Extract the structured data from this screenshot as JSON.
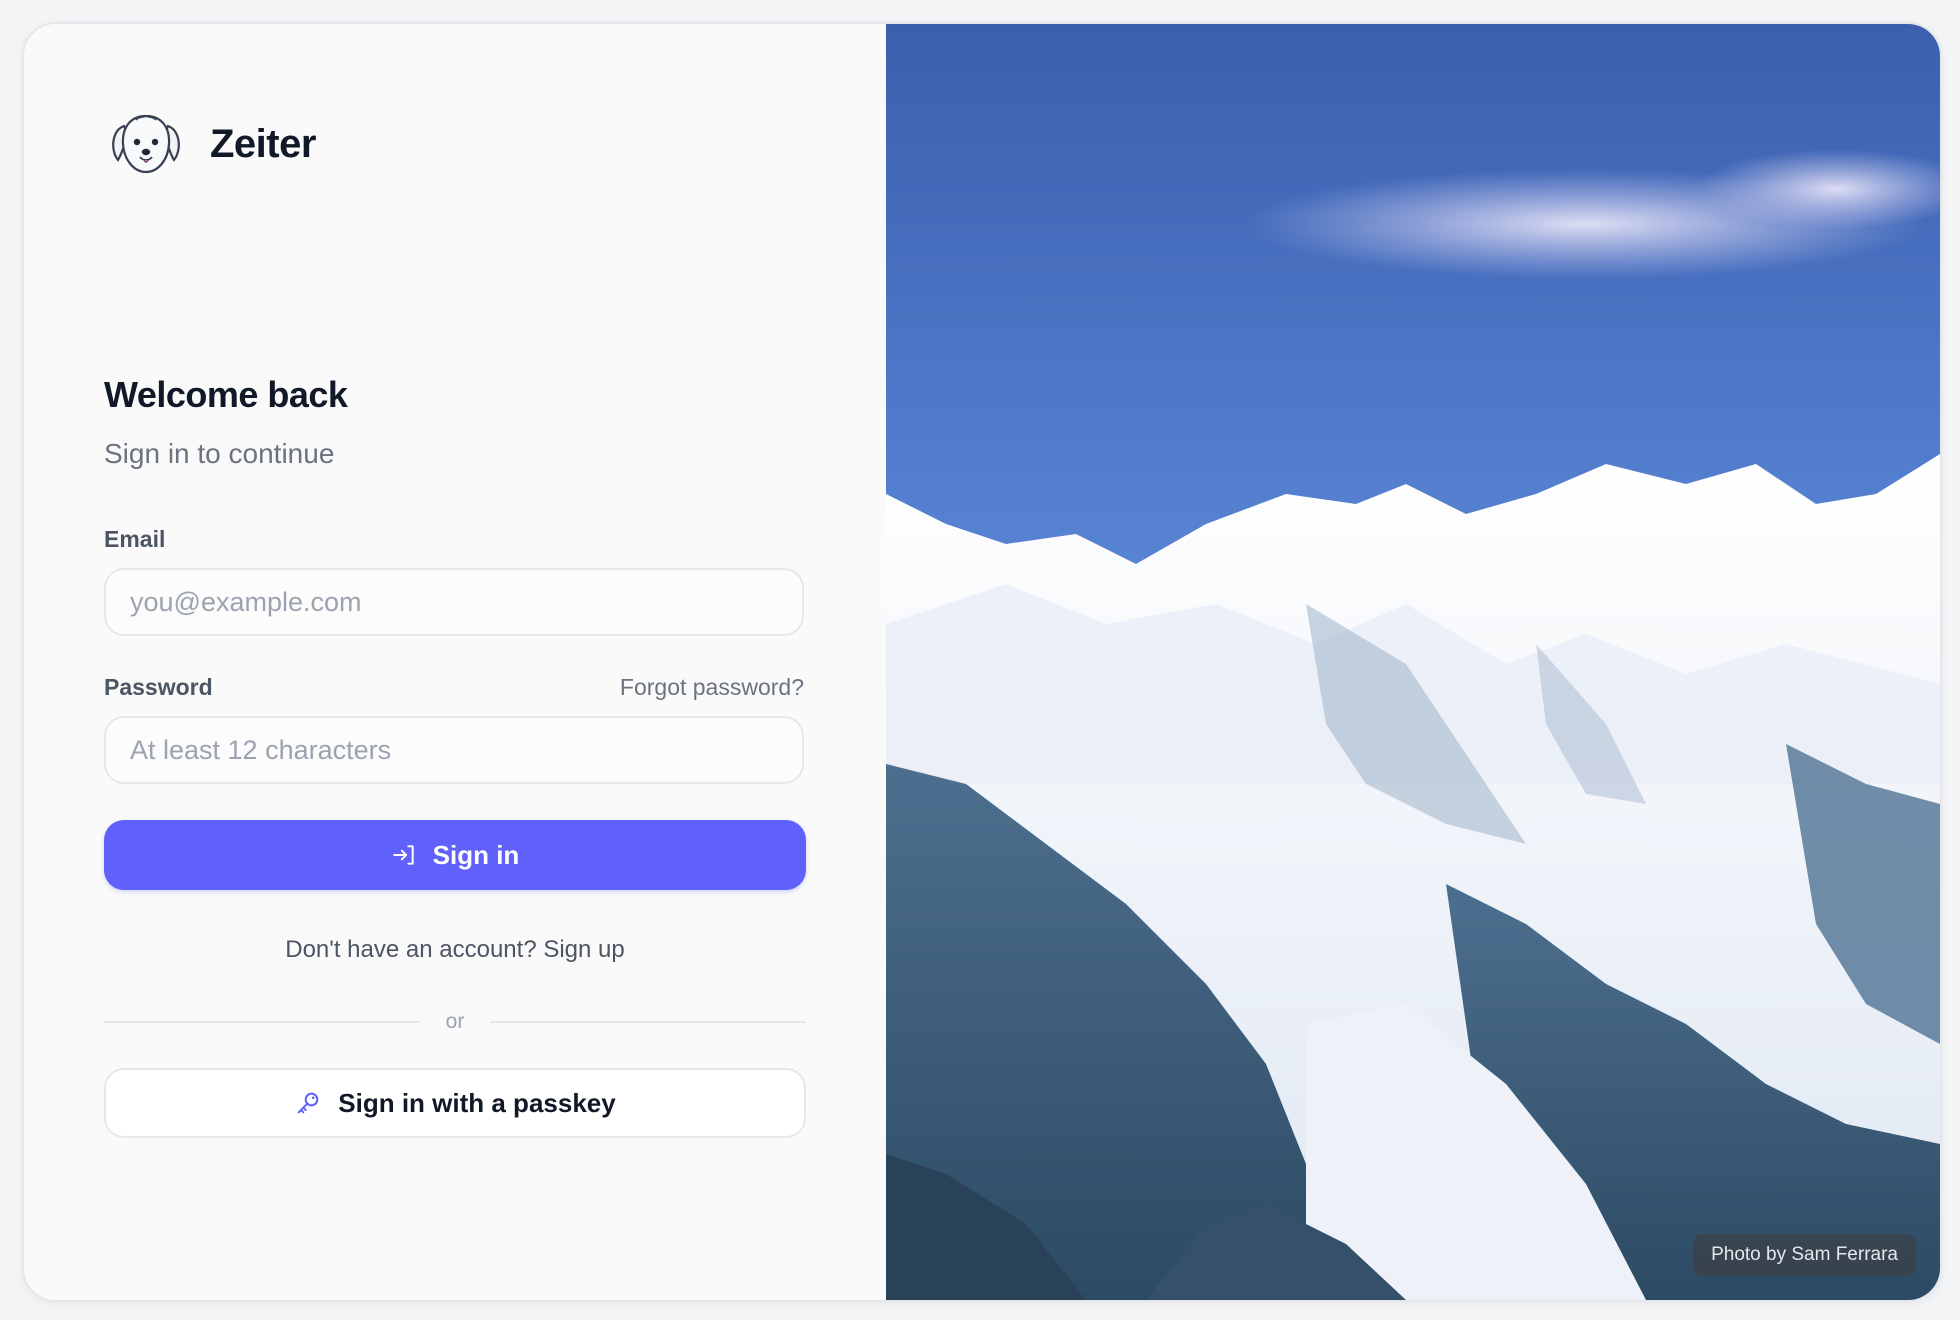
{
  "brand": {
    "name": "Zeiter",
    "logo_icon": "dog-face-icon"
  },
  "form": {
    "heading": "Welcome back",
    "subheading": "Sign in to continue",
    "email": {
      "label": "Email",
      "placeholder": "you@example.com",
      "value": ""
    },
    "password": {
      "label": "Password",
      "placeholder": "At least 12 characters",
      "value": "",
      "forgot_label": "Forgot password?"
    },
    "sign_in_button": {
      "label": "Sign in",
      "icon": "sign-in-arrow-icon"
    },
    "signup_prompt": "Don't have an account?",
    "signup_link": "Sign up",
    "divider_text": "or",
    "passkey_button": {
      "label": "Sign in with a passkey",
      "icon": "key-icon"
    }
  },
  "hero": {
    "credit": "Photo by Sam Ferrara"
  },
  "colors": {
    "accent": "#6060fb",
    "text_primary": "#111827",
    "text_muted": "#6b7280",
    "border": "#e5e7eb",
    "sky_top": "#3c64b4",
    "sky_bottom": "#6b97e3"
  }
}
